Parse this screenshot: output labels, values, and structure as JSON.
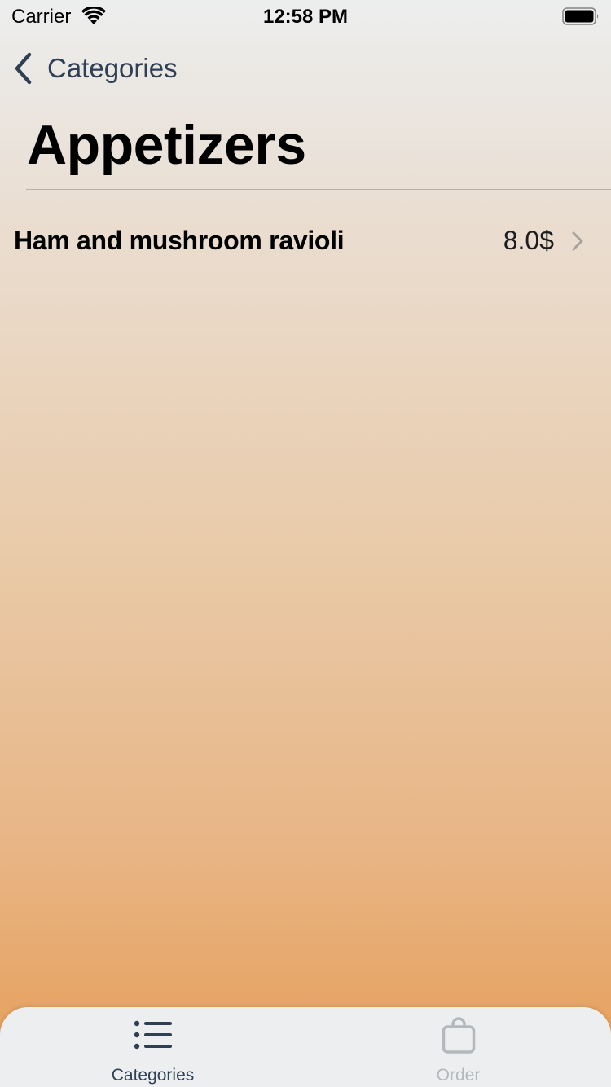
{
  "status_bar": {
    "carrier": "Carrier",
    "time": "12:58 PM",
    "wifi_icon": "wifi-icon",
    "battery_icon": "battery-icon"
  },
  "nav": {
    "back_label": "Categories",
    "back_icon": "chevron-left-icon"
  },
  "page": {
    "title": "Appetizers"
  },
  "items": [
    {
      "name": "Ham and mushroom ravioli",
      "price": "8.0$",
      "icon": "chevron-right-icon"
    }
  ],
  "tab_bar": {
    "tabs": [
      {
        "label": "Categories",
        "icon": "list-icon",
        "selected": true
      },
      {
        "label": "Order",
        "icon": "bag-icon",
        "selected": false
      }
    ]
  },
  "colors": {
    "accent": "#2f4055",
    "tab_inactive": "#b4b8bc",
    "gradient_top": "#eceeee",
    "gradient_bottom": "#e69d57"
  }
}
